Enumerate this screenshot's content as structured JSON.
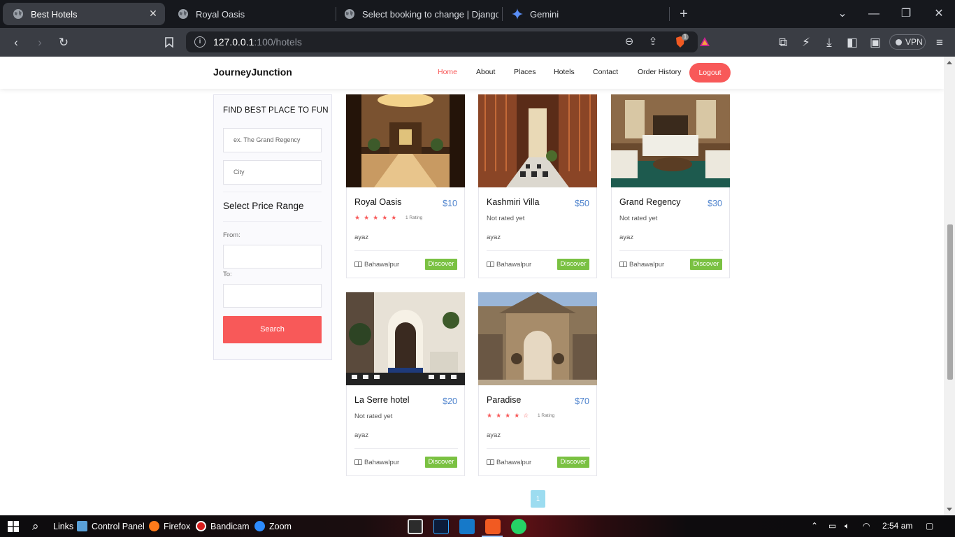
{
  "browser": {
    "tabs": [
      {
        "title": "Best Hotels",
        "active": true
      },
      {
        "title": "Royal Oasis",
        "active": false
      },
      {
        "title": "Select booking to change | Django s",
        "active": false
      },
      {
        "title": "Gemini",
        "active": false
      }
    ],
    "url_host": "127.0.0.1",
    "url_rest": ":100/hotels",
    "shield_badge": "1",
    "vpn_label": "VPN"
  },
  "site": {
    "brand": "JourneyJunction",
    "nav": [
      "Home",
      "About",
      "Places",
      "Hotels",
      "Contact",
      "Order History"
    ],
    "logout": "Logout"
  },
  "sidebar": {
    "title": "FIND BEST PLACE TO FUN",
    "name_placeholder": "ex. The Grand Regency",
    "city_placeholder": "City",
    "range_title": "Select Price Range",
    "from_label": "From:",
    "to_label": "To:",
    "search_label": "Search"
  },
  "hotels": [
    {
      "name": "Royal Oasis",
      "price": "$10",
      "stars": 5,
      "rating_count": "1 Rating",
      "rating_text": "",
      "owner": "ayaz",
      "location": "Bahawalpur",
      "cta": "Discover"
    },
    {
      "name": "Kashmiri Villa",
      "price": "$50",
      "stars": 0,
      "rating_count": "",
      "rating_text": "Not rated yet",
      "owner": "ayaz",
      "location": "Bahawalpur",
      "cta": "Discover"
    },
    {
      "name": "Grand Regency",
      "price": "$30",
      "stars": 0,
      "rating_count": "",
      "rating_text": "Not rated yet",
      "owner": "ayaz",
      "location": "Bahawalpur",
      "cta": "Discover"
    },
    {
      "name": "La Serre hotel",
      "price": "$20",
      "stars": 0,
      "rating_count": "",
      "rating_text": "Not rated yet",
      "owner": "ayaz",
      "location": "Bahawalpur",
      "cta": "Discover"
    },
    {
      "name": "Paradise",
      "price": "$70",
      "stars": 4,
      "rating_count": "1 Rating",
      "rating_text": "",
      "owner": "ayaz",
      "location": "Bahawalpur",
      "cta": "Discover"
    }
  ],
  "pagination": {
    "current": "1"
  },
  "taskbar": {
    "links": "Links",
    "control_panel": "Control Panel",
    "firefox": "Firefox",
    "bandicam": "Bandicam",
    "zoom": "Zoom",
    "time": "2:54 am"
  },
  "colors": {
    "accent": "#f85959",
    "price": "#4a80cc",
    "discover": "#7ac142",
    "page": "#9cdcf0"
  }
}
